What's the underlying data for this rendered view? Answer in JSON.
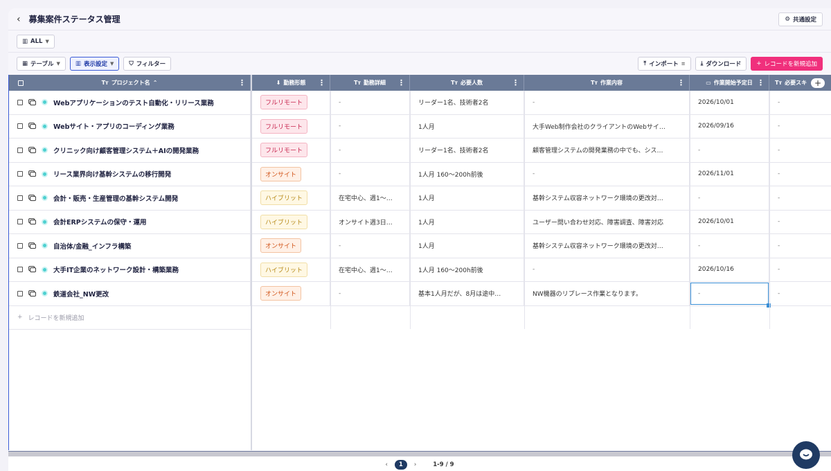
{
  "header": {
    "title": "募集案件ステータス管理",
    "common_settings": "共通設定"
  },
  "view": {
    "label": "ALL"
  },
  "toolbar": {
    "table": "テーブル",
    "display": "表示設定",
    "filter": "フィルター",
    "import": "インポート",
    "download": "ダウンロード",
    "add_record": "レコードを新規追加"
  },
  "columns": {
    "name": "プロジェクト名",
    "work_style": "勤務形態",
    "work_detail": "勤務詳細",
    "headcount": "必要人数",
    "content": "作業内容",
    "start_date": "作業開始予定日",
    "skills": "必要スキ"
  },
  "rows": [
    {
      "name": "Webアプリケーションのテスト自動化・リリース業務",
      "style": "フルリモート",
      "style_type": "full",
      "detail": "-",
      "headcount": "リーダー1名、技術者2名",
      "content": "-",
      "start": "2026/10/01",
      "skills": "-"
    },
    {
      "name": "Webサイト・アプリのコーディング業務",
      "style": "フルリモート",
      "style_type": "full",
      "detail": "-",
      "headcount": "1人月",
      "content": "大手Web制作会社のクライアントのWebサイ…",
      "start": "2026/09/16",
      "skills": "-"
    },
    {
      "name": "クリニック向け顧客管理システム＋AIの開発業務",
      "style": "フルリモート",
      "style_type": "full",
      "detail": "-",
      "headcount": "リーダー1名、技術者2名",
      "content": "顧客管理システムの開発業務の中でも、シス…",
      "start": "-",
      "skills": "-"
    },
    {
      "name": "リース業界向け基幹システムの移行開発",
      "style": "オンサイト",
      "style_type": "on",
      "detail": "-",
      "headcount": "1人月 160～200h前後",
      "content": "-",
      "start": "2026/11/01",
      "skills": "-"
    },
    {
      "name": "会計・販売・生産管理の基幹システム開発",
      "style": "ハイブリット",
      "style_type": "hyb",
      "detail": "在宅中心、週1～…",
      "headcount": "1人月",
      "content": "基幹システム収容ネットワーク環境の更改対…",
      "start": "-",
      "skills": "-"
    },
    {
      "name": "会計ERPシステムの保守・運用",
      "style": "ハイブリット",
      "style_type": "hyb",
      "detail": "オンサイト週3日…",
      "headcount": "1人月",
      "content": "ユーザー問い合わせ対応、障害調査、障害対応",
      "start": "2026/10/01",
      "skills": "-"
    },
    {
      "name": "自治体/金融_インフラ構築",
      "style": "オンサイト",
      "style_type": "on",
      "detail": "-",
      "headcount": "1人月",
      "content": "基幹システム収容ネットワーク環境の更改対…",
      "start": "-",
      "skills": "-"
    },
    {
      "name": "大手IT企業のネットワーク設計・構築業務",
      "style": "ハイブリット",
      "style_type": "hyb",
      "detail": "在宅中心、週1～…",
      "headcount": "1人月 160～200h前後",
      "content": "-",
      "start": "2026/10/16",
      "skills": "-"
    },
    {
      "name": "鉄道会社_NW更改",
      "style": "オンサイト",
      "style_type": "on",
      "detail": "-",
      "headcount": "基本1人月だが、8月は途中…",
      "content": "NW機器のリプレース作業となります。",
      "start": "-",
      "skills": "-"
    }
  ],
  "add_row_label": "レコードを新規追加",
  "pager": {
    "current": "1",
    "range": "1-9 / 9"
  }
}
